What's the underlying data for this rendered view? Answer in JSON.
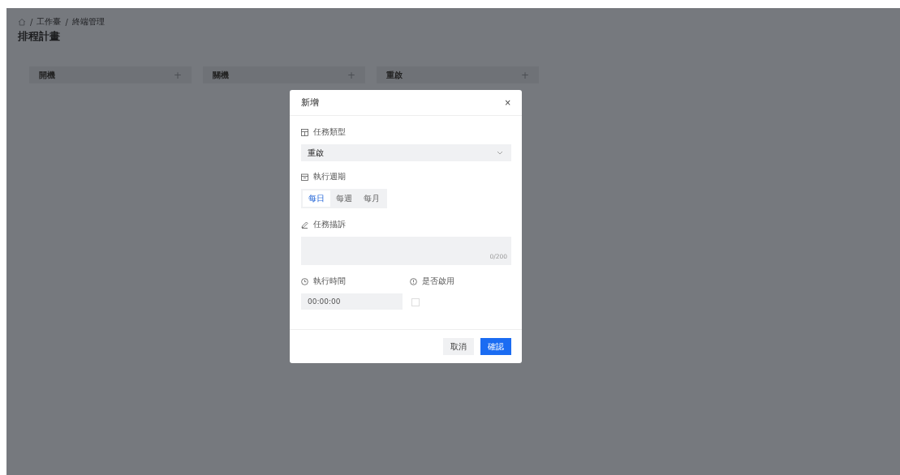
{
  "breadcrumb": {
    "separator": "/",
    "items": [
      "工作臺",
      "終端管理"
    ]
  },
  "page_title": "排程計畫",
  "columns": [
    {
      "title": "開機",
      "add": "+"
    },
    {
      "title": "關機",
      "add": "+"
    },
    {
      "title": "重啟",
      "add": "+"
    }
  ],
  "dialog": {
    "title": "新增",
    "close": "×",
    "task_type": {
      "label": "任務類型",
      "value": "重啟"
    },
    "cycle": {
      "label": "執行週期",
      "options": [
        {
          "label": "每日",
          "selected": true
        },
        {
          "label": "每週",
          "selected": false
        },
        {
          "label": "每月",
          "selected": false
        }
      ]
    },
    "description": {
      "label": "任務描訴",
      "counter": "0/200"
    },
    "time": {
      "label": "執行時間",
      "value": "00:00:00"
    },
    "enabled": {
      "label": "是否啟用",
      "checked": false
    },
    "buttons": [
      {
        "label": "取消",
        "kind": "secondary"
      },
      {
        "label": "確認",
        "kind": "primary"
      }
    ]
  }
}
